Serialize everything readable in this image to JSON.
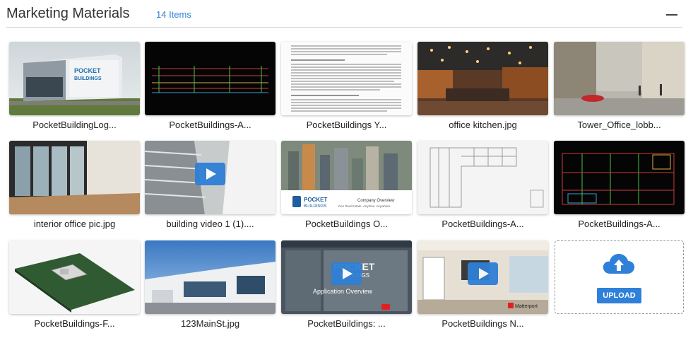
{
  "header": {
    "title": "Marketing Materials",
    "count": "14 Items"
  },
  "items": [
    {
      "caption": "PocketBuildingLog...",
      "video": false
    },
    {
      "caption": "PocketBuildings-A...",
      "video": false
    },
    {
      "caption": "PocketBuildings Y...",
      "video": false
    },
    {
      "caption": "office kitchen.jpg",
      "video": false
    },
    {
      "caption": "Tower_Office_lobb...",
      "video": false
    },
    {
      "caption": "interior office pic.jpg",
      "video": false
    },
    {
      "caption": "building video 1 (1)....",
      "video": true
    },
    {
      "caption": "PocketBuildings O...",
      "video": false
    },
    {
      "caption": "PocketBuildings-A...",
      "video": false
    },
    {
      "caption": "PocketBuildings-A...",
      "video": false
    },
    {
      "caption": "PocketBuildings-F...",
      "video": false
    },
    {
      "caption": "123MainSt.jpg",
      "video": false
    },
    {
      "caption": "PocketBuildings: ...",
      "video": true
    },
    {
      "caption": "PocketBuildings N...",
      "video": true
    }
  ],
  "thumb_text": {
    "logo_line1": "POCKET",
    "logo_line2": "BUILDINGS",
    "company_overview": "Company Overview",
    "tagline": "Your Real Estate.  Anytime.  Anywhere.",
    "app_overview": "Application Overview",
    "matterport": "Matterport"
  },
  "upload": {
    "label": "UPLOAD",
    "icon": "cloud-upload-icon"
  },
  "colors": {
    "accent": "#2f80d8",
    "play": "#2f7fd6"
  }
}
